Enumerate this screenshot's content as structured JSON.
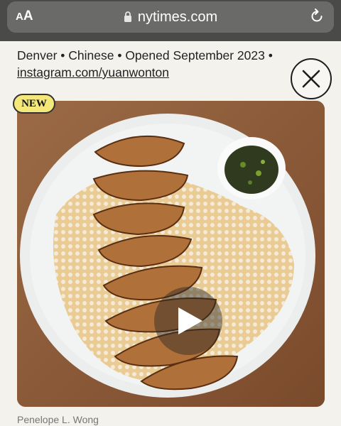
{
  "browser": {
    "text_size_label": "AA",
    "url": "nytimes.com"
  },
  "article": {
    "meta_line": "Denver • Chinese • Opened September 2023 •",
    "link": "instagram.com/yuanwonton",
    "badge": "NEW",
    "photo_credit": "Penelope L. Wong"
  },
  "colors": {
    "badge": "#f4e87a",
    "browser_bar": "#4a4a48"
  },
  "icons": [
    "lock-icon",
    "reload-icon",
    "close-icon",
    "play-icon"
  ]
}
